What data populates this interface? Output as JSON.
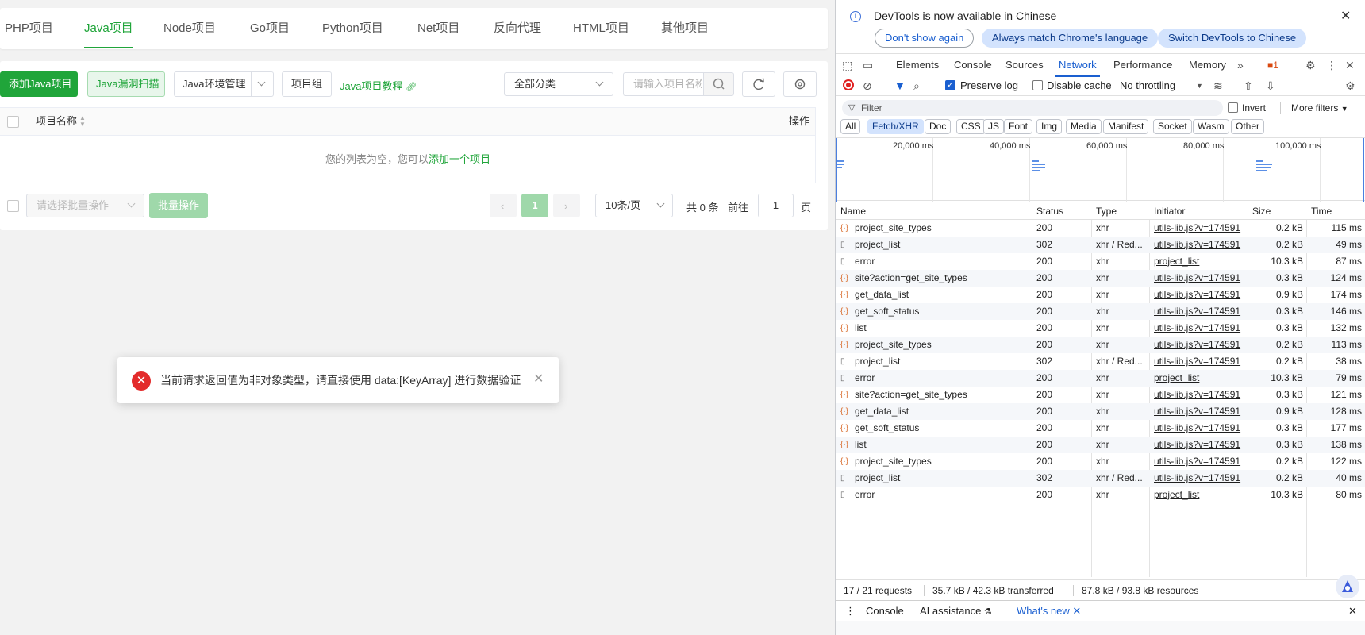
{
  "app": {
    "tabs": [
      "PHP项目",
      "Java项目",
      "Node项目",
      "Go项目",
      "Python项目",
      "Net项目",
      "反向代理",
      "HTML项目",
      "其他项目"
    ],
    "active_tab": "Java项目",
    "toolbar": {
      "add_button": "添加Java项目",
      "scan_button": "Java漏洞扫描",
      "env_button": "Java环境管理",
      "group_button": "项目组",
      "tutorial_link": "Java项目教程",
      "category_select": "全部分类",
      "search_placeholder": "请输入项目名称"
    },
    "table": {
      "col_name": "项目名称",
      "col_actions": "操作",
      "empty_text": "您的列表为空，您可以",
      "empty_link": "添加一个项目"
    },
    "footer": {
      "batch_placeholder": "请选择批量操作",
      "batch_button": "批量操作",
      "current_page": "1",
      "page_size": "10条/页",
      "total": "共 0 条",
      "goto_label": "前往",
      "goto_value": "1",
      "page_suffix": "页"
    },
    "toast": {
      "message": "当前请求返回值为非对象类型，请直接使用 data:[KeyArray] 进行数据验证"
    }
  },
  "devtools": {
    "banner": {
      "title": "DevTools is now available in Chinese",
      "btn_dont_show": "Don't show again",
      "btn_match": "Always match Chrome's language",
      "btn_switch": "Switch DevTools to Chinese"
    },
    "tabs": [
      "Elements",
      "Console",
      "Sources",
      "Network",
      "Performance",
      "Memory"
    ],
    "active_tab": "Network",
    "issues_count": "1",
    "toolbar": {
      "preserve_log": "Preserve log",
      "disable_cache": "Disable cache",
      "throttling": "No throttling"
    },
    "filter": {
      "placeholder": "Filter",
      "invert": "Invert",
      "more_filters": "More filters"
    },
    "type_chips": [
      "All",
      "Fetch/XHR",
      "Doc",
      "CSS",
      "JS",
      "Font",
      "Img",
      "Media",
      "Manifest",
      "Socket",
      "Wasm",
      "Other"
    ],
    "active_chip": "Fetch/XHR",
    "overview_ticks": [
      "20,000 ms",
      "40,000 ms",
      "60,000 ms",
      "80,000 ms",
      "100,000 ms"
    ],
    "columns": [
      "Name",
      "Status",
      "Type",
      "Initiator",
      "Size",
      "Time"
    ],
    "requests": [
      {
        "icon": "xhr",
        "name": "project_site_types",
        "status": "200",
        "type": "xhr",
        "initiator": "utils-lib.js?v=174591",
        "size": "0.2 kB",
        "time": "115 ms"
      },
      {
        "icon": "doc",
        "name": "project_list",
        "status": "302",
        "type": "xhr / Red...",
        "initiator": "utils-lib.js?v=174591",
        "size": "0.2 kB",
        "time": "49 ms"
      },
      {
        "icon": "doc",
        "name": "error",
        "status": "200",
        "type": "xhr",
        "initiator": "project_list",
        "size": "10.3 kB",
        "time": "87 ms"
      },
      {
        "icon": "xhr",
        "name": "site?action=get_site_types",
        "status": "200",
        "type": "xhr",
        "initiator": "utils-lib.js?v=174591",
        "size": "0.3 kB",
        "time": "124 ms"
      },
      {
        "icon": "xhr",
        "name": "get_data_list",
        "status": "200",
        "type": "xhr",
        "initiator": "utils-lib.js?v=174591",
        "size": "0.9 kB",
        "time": "174 ms"
      },
      {
        "icon": "xhr",
        "name": "get_soft_status",
        "status": "200",
        "type": "xhr",
        "initiator": "utils-lib.js?v=174591",
        "size": "0.3 kB",
        "time": "146 ms"
      },
      {
        "icon": "xhr",
        "name": "list",
        "status": "200",
        "type": "xhr",
        "initiator": "utils-lib.js?v=174591",
        "size": "0.3 kB",
        "time": "132 ms"
      },
      {
        "icon": "xhr",
        "name": "project_site_types",
        "status": "200",
        "type": "xhr",
        "initiator": "utils-lib.js?v=174591",
        "size": "0.2 kB",
        "time": "113 ms"
      },
      {
        "icon": "doc",
        "name": "project_list",
        "status": "302",
        "type": "xhr / Red...",
        "initiator": "utils-lib.js?v=174591",
        "size": "0.2 kB",
        "time": "38 ms"
      },
      {
        "icon": "doc",
        "name": "error",
        "status": "200",
        "type": "xhr",
        "initiator": "project_list",
        "size": "10.3 kB",
        "time": "79 ms"
      },
      {
        "icon": "xhr",
        "name": "site?action=get_site_types",
        "status": "200",
        "type": "xhr",
        "initiator": "utils-lib.js?v=174591",
        "size": "0.3 kB",
        "time": "121 ms"
      },
      {
        "icon": "xhr",
        "name": "get_data_list",
        "status": "200",
        "type": "xhr",
        "initiator": "utils-lib.js?v=174591",
        "size": "0.9 kB",
        "time": "128 ms"
      },
      {
        "icon": "xhr",
        "name": "get_soft_status",
        "status": "200",
        "type": "xhr",
        "initiator": "utils-lib.js?v=174591",
        "size": "0.3 kB",
        "time": "177 ms"
      },
      {
        "icon": "xhr",
        "name": "list",
        "status": "200",
        "type": "xhr",
        "initiator": "utils-lib.js?v=174591",
        "size": "0.3 kB",
        "time": "138 ms"
      },
      {
        "icon": "xhr",
        "name": "project_site_types",
        "status": "200",
        "type": "xhr",
        "initiator": "utils-lib.js?v=174591",
        "size": "0.2 kB",
        "time": "122 ms"
      },
      {
        "icon": "doc",
        "name": "project_list",
        "status": "302",
        "type": "xhr / Red...",
        "initiator": "utils-lib.js?v=174591",
        "size": "0.2 kB",
        "time": "40 ms"
      },
      {
        "icon": "doc",
        "name": "error",
        "status": "200",
        "type": "xhr",
        "initiator": "project_list",
        "size": "10.3 kB",
        "time": "80 ms"
      }
    ],
    "summary": {
      "requests": "17 / 21 requests",
      "transferred": "35.7 kB / 42.3 kB transferred",
      "resources": "87.8 kB / 93.8 kB resources"
    },
    "drawer": {
      "tabs": [
        "Console",
        "AI assistance",
        "What's new"
      ],
      "active": "What's new"
    }
  }
}
